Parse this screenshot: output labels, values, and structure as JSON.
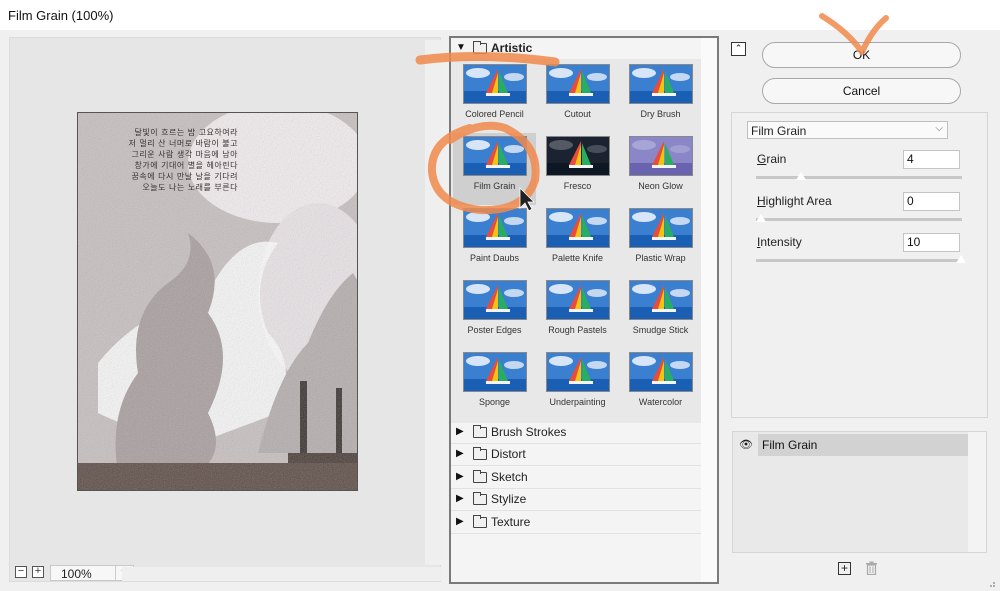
{
  "window": {
    "title": "Film Grain (100%)"
  },
  "preview": {
    "poem_lines": [
      "달빛이 흐르는 밤 고요하여라",
      "저 멀리 산 너머로 바람이 불고",
      "그리운 사람 생각 마음에 남아",
      "창가에 기대어 별을 헤아린다",
      "꿈속에 다시 만날 날을 기다려",
      "오늘도 나는 노래를 부른다"
    ],
    "zoom": {
      "minus": "−",
      "plus": "+",
      "value": "100%"
    }
  },
  "gallery": {
    "open_category": "Artistic",
    "thumbnails": [
      "Colored Pencil",
      "Cutout",
      "Dry Brush",
      "Film Grain",
      "Fresco",
      "Neon Glow",
      "Paint Daubs",
      "Palette Knife",
      "Plastic Wrap",
      "Poster Edges",
      "Rough Pastels",
      "Smudge Stick",
      "Sponge",
      "Underpainting",
      "Watercolor"
    ],
    "selected": "Film Grain",
    "collapsed_categories": [
      "Brush Strokes",
      "Distort",
      "Sketch",
      "Stylize",
      "Texture"
    ]
  },
  "buttons": {
    "ok": "OK",
    "cancel": "Cancel"
  },
  "settings": {
    "filter": "Film Grain",
    "params": [
      {
        "label": "Grain",
        "mnemonic": "G",
        "rest": "rain",
        "value": "4",
        "level": 0.2
      },
      {
        "label": "Highlight Area",
        "mnemonic": "H",
        "rest": "ighlight Area",
        "value": "0",
        "level": 0.0
      },
      {
        "label": "Intensity",
        "mnemonic": "I",
        "rest": "ntensity",
        "value": "10",
        "level": 1.0
      }
    ]
  },
  "layers": {
    "items": [
      "Film Grain"
    ]
  },
  "icons": {
    "collapse": "collapse-up-icon",
    "eye": "eye-icon",
    "new_layer": "new-effect-layer-icon",
    "delete": "trash-icon"
  },
  "colors": {
    "annotation": "#f08a4b",
    "sky": "#3b7fd0",
    "sea": "#1a5fb4"
  }
}
